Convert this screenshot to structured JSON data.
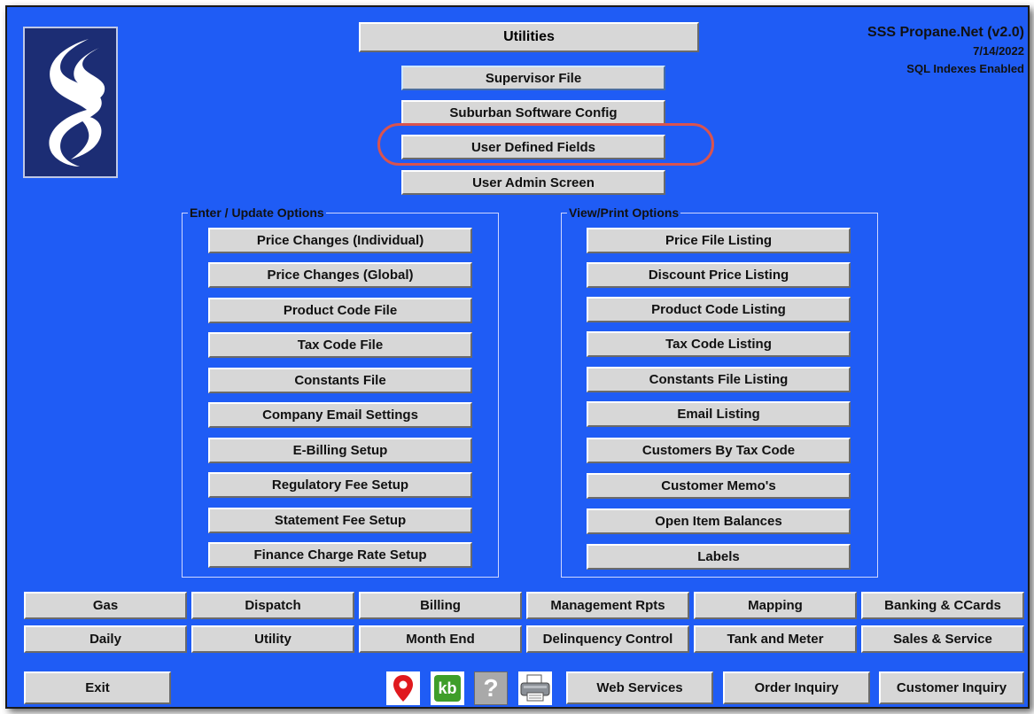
{
  "header": {
    "title": "Utilities",
    "app_name": "SSS Propane.Net (v2.0)",
    "date": "7/14/2022",
    "status": "SQL Indexes Enabled"
  },
  "top_buttons": [
    {
      "label": "Supervisor File"
    },
    {
      "label": "Suburban Software Config"
    },
    {
      "label": "User Defined Fields"
    },
    {
      "label": "User Admin Screen"
    }
  ],
  "enter_update": {
    "label": "Enter / Update Options",
    "items": [
      {
        "label": "Price Changes (Individual)"
      },
      {
        "label": "Price Changes (Global)"
      },
      {
        "label": "Product Code File"
      },
      {
        "label": "Tax Code File"
      },
      {
        "label": "Constants File"
      },
      {
        "label": "Company Email Settings"
      },
      {
        "label": "E-Billing Setup"
      },
      {
        "label": "Regulatory Fee Setup"
      },
      {
        "label": "Statement Fee Setup"
      },
      {
        "label": "Finance Charge Rate Setup"
      }
    ]
  },
  "view_print": {
    "label": "View/Print Options",
    "items": [
      {
        "label": "Price File Listing"
      },
      {
        "label": "Discount Price Listing"
      },
      {
        "label": "Product Code Listing"
      },
      {
        "label": "Tax Code Listing"
      },
      {
        "label": "Constants File Listing"
      },
      {
        "label": "Email Listing"
      },
      {
        "label": "Customers By Tax Code"
      },
      {
        "label": "Customer Memo's"
      },
      {
        "label": "Open Item Balances"
      },
      {
        "label": "Labels"
      }
    ]
  },
  "nav_row1": [
    {
      "label": "Gas"
    },
    {
      "label": "Dispatch"
    },
    {
      "label": "Billing"
    },
    {
      "label": "Management Rpts"
    },
    {
      "label": "Mapping"
    },
    {
      "label": "Banking & CCards"
    }
  ],
  "nav_row2": [
    {
      "label": "Daily"
    },
    {
      "label": "Utility"
    },
    {
      "label": "Month End"
    },
    {
      "label": "Delinquency Control"
    },
    {
      "label": "Tank and Meter"
    },
    {
      "label": "Sales & Service"
    }
  ],
  "bottom": {
    "exit": "Exit",
    "kb_icon_text": "kb",
    "help_icon_text": "?",
    "web_services": "Web Services",
    "order_inquiry": "Order Inquiry",
    "customer_inquiry": "Customer Inquiry"
  },
  "icons": [
    "map-pin-icon",
    "kb-icon",
    "help-icon",
    "printer-icon"
  ],
  "colors": {
    "background": "#1f5cf5",
    "button": "#d7d7d7",
    "highlight": "#d9534f"
  }
}
